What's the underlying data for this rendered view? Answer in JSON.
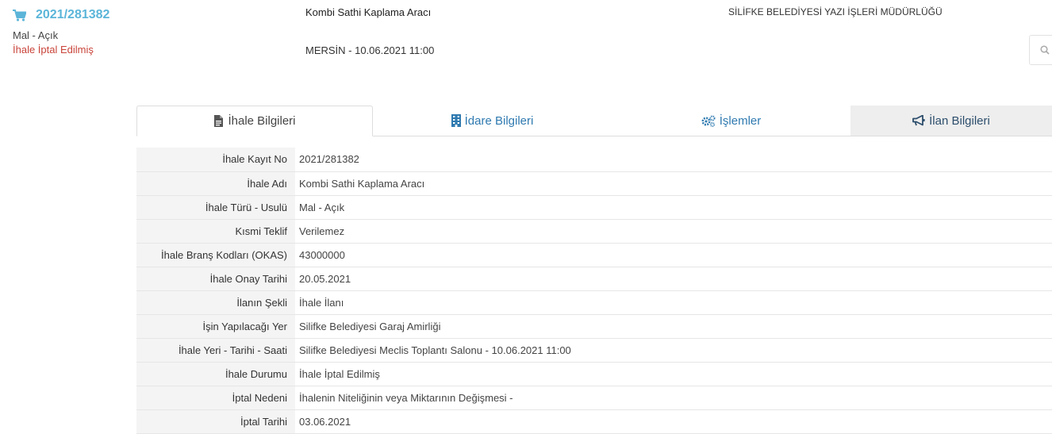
{
  "header": {
    "tender_no": "2021/281382",
    "tender_type": "Mal - Açık",
    "tender_status": "İhale İptal Edilmiş",
    "title": "Kombi Sathi Kaplama Aracı",
    "place_date": "MERSİN - 10.06.2021 11:00",
    "administration": "SİLİFKE BELEDİYESİ YAZI İŞLERİ MÜDÜRLÜĞÜ",
    "search_icon": "search-icon"
  },
  "tabs": [
    {
      "label": "İhale Bilgileri",
      "icon": "file-icon",
      "active": true
    },
    {
      "label": "İdare Bilgileri",
      "icon": "building-icon",
      "active": false
    },
    {
      "label": "İşlemler",
      "icon": "gears-icon",
      "active": false
    },
    {
      "label": "İlan Bilgileri",
      "icon": "megaphone-icon",
      "active": false
    }
  ],
  "details": [
    {
      "label": "İhale Kayıt No",
      "value": "2021/281382"
    },
    {
      "label": "İhale Adı",
      "value": "Kombi Sathi Kaplama Aracı"
    },
    {
      "label": "İhale Türü - Usulü",
      "value": "Mal - Açık"
    },
    {
      "label": "Kısmi Teklif",
      "value": "Verilemez"
    },
    {
      "label": "İhale Branş Kodları (OKAS)",
      "value": "43000000"
    },
    {
      "label": "İhale Onay Tarihi",
      "value": "20.05.2021"
    },
    {
      "label": "İlanın Şekli",
      "value": "İhale İlanı"
    },
    {
      "label": "İşin Yapılacağı Yer",
      "value": "Silifke Belediyesi Garaj Amirliği"
    },
    {
      "label": "İhale Yeri - Tarihi - Saati",
      "value": "Silifke Belediyesi Meclis Toplantı Salonu - 10.06.2021 11:00"
    },
    {
      "label": "İhale Durumu",
      "value": "İhale İptal Edilmiş"
    },
    {
      "label": "İptal Nedeni",
      "value": "İhalenin Niteliğinin veya Miktarının Değişmesi -"
    },
    {
      "label": "İptal Tarihi",
      "value": "03.06.2021"
    }
  ],
  "colors": {
    "accent": "#5bb5d9",
    "status_red": "#c9443a",
    "tab_link": "#2f7ab0"
  }
}
